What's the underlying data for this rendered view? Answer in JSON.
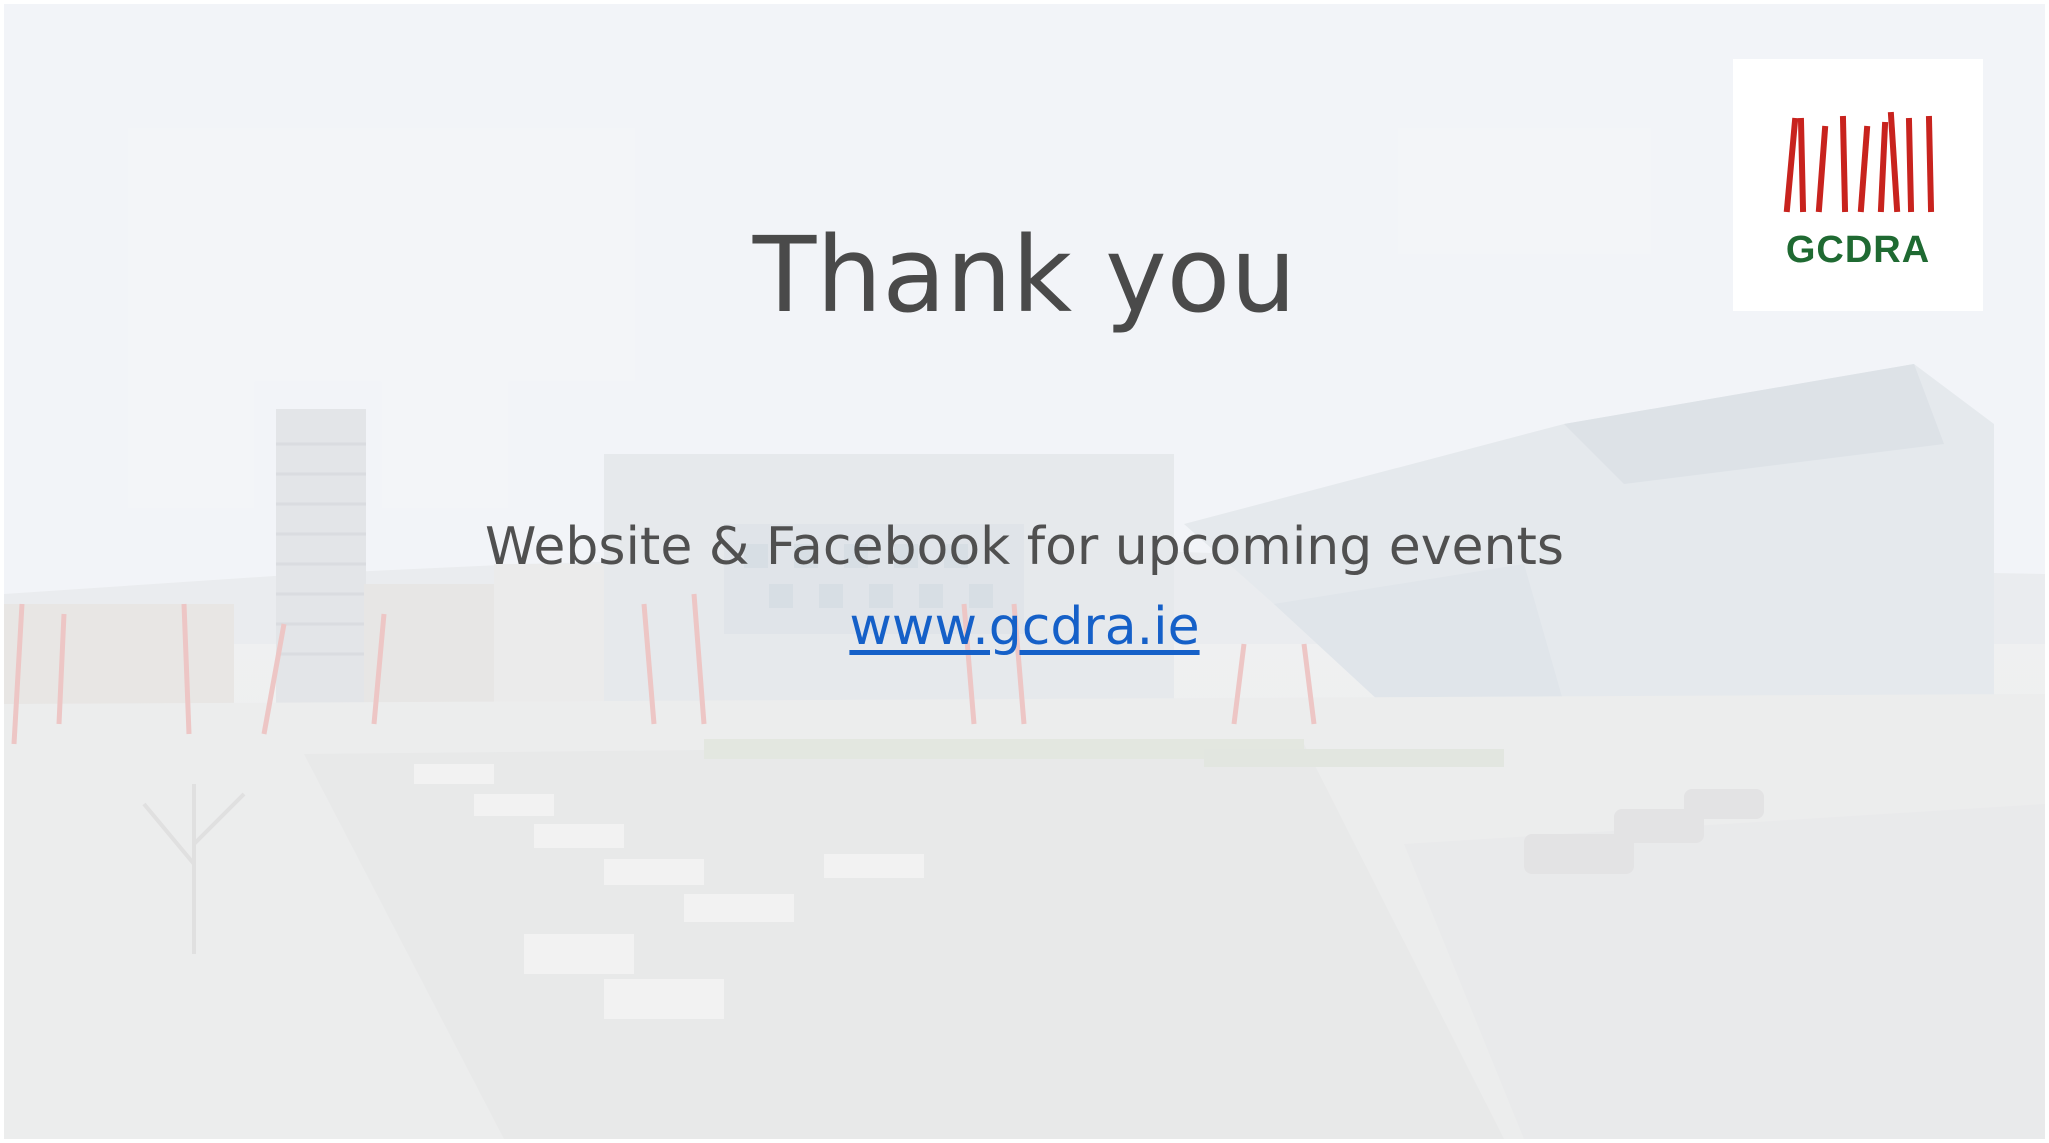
{
  "slide": {
    "title": "Thank you",
    "subtitle": "Website & Facebook for upcoming events",
    "link_text": "www.gcdra.ie",
    "link_color": "#1560c8",
    "title_color": "#4a4a4a"
  },
  "logo": {
    "text": "GCDRA",
    "text_color": "#1f6a32",
    "bar_color": "#c8231e"
  },
  "background": {
    "description_icon": "docklands-plaza-photo"
  }
}
